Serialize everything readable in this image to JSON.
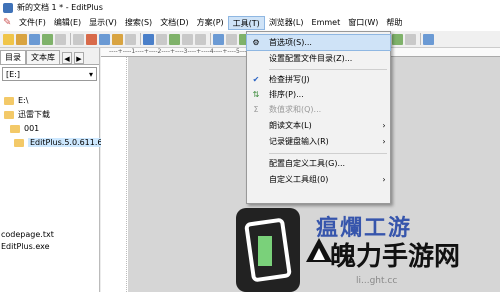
{
  "window": {
    "title": "新的文档 1 * - EditPlus"
  },
  "menubar": {
    "items": [
      {
        "label": "文件(F)"
      },
      {
        "label": "编辑(E)"
      },
      {
        "label": "显示(V)"
      },
      {
        "label": "搜索(S)"
      },
      {
        "label": "文档(D)"
      },
      {
        "label": "方案(P)"
      },
      {
        "label": "工具(T)"
      },
      {
        "label": "浏览器(L)"
      },
      {
        "label": "Emmet"
      },
      {
        "label": "窗口(W)"
      },
      {
        "label": "帮助"
      }
    ],
    "active_index": 6
  },
  "toolbar": {
    "button_colors": [
      "#f0c54a",
      "#d9a441",
      "#6b9ad4",
      "#7fb26a",
      "#c9c9c9",
      "#c9c9c9",
      "#d86a4a",
      "#6b9ad4",
      "#d9a441",
      "#c9c9c9",
      "#4a7fc9",
      "#c9c9c9",
      "#7fb26a",
      "#c9c9c9",
      "#c9c9c9",
      "#6b9ad4",
      "#c9c9c9",
      "#7fb26a",
      "#c9c9c9",
      "#4a7fc9",
      "#c9c9c9",
      "#6b9ad4",
      "#c9c9c9",
      "#c9c9c9",
      "#d9a441",
      "#c9c9c9",
      "#6b9ad4",
      "#c9c9c9",
      "#7fb26a",
      "#c9c9c9",
      "#6b9ad4"
    ]
  },
  "sidebar": {
    "tabs": [
      {
        "label": "目录"
      },
      {
        "label": "文本库"
      }
    ],
    "arrows": {
      "left": "◀",
      "right": "▶"
    },
    "drive": "[E:]",
    "tree": [
      {
        "label": "E:\\"
      },
      {
        "label": "迅雷下载"
      },
      {
        "label": "001"
      },
      {
        "label": "EditPlus.5.0.611.6"
      }
    ],
    "files": [
      {
        "label": "codepage.txt"
      },
      {
        "label": "EditPlus.exe"
      }
    ]
  },
  "editor": {
    "ruler": "----+----1----+----2----+----3----+----4----+----5----+----6----+----7----+"
  },
  "dropdown": {
    "items": [
      {
        "label": "首选项(S)...",
        "icon": "⚙",
        "icon_name": "gear-icon",
        "highlight": true
      },
      {
        "label": "设置配置文件目录(Z)..."
      },
      {
        "label": "检查拼写(J)",
        "icon": "✔",
        "icon_name": "spellcheck-icon"
      },
      {
        "label": "排序(P)...",
        "icon": "⇅",
        "icon_name": "sort-icon"
      },
      {
        "label": "数值求和(Q)...",
        "icon": "Σ",
        "icon_name": "sum-icon",
        "disabled": true
      },
      {
        "label": "朗读文本(L)",
        "submenu": true
      },
      {
        "label": "记录键盘输入(R)",
        "submenu": true
      },
      {
        "label": "配置自定义工具(G)..."
      },
      {
        "label": "自定义工具组(0)",
        "submenu": true
      }
    ],
    "submenu_arrow": "›"
  },
  "watermark": {
    "top_text": "瘟爛工游",
    "main_text": "魄力手游网",
    "url": "li...ght.cc"
  }
}
